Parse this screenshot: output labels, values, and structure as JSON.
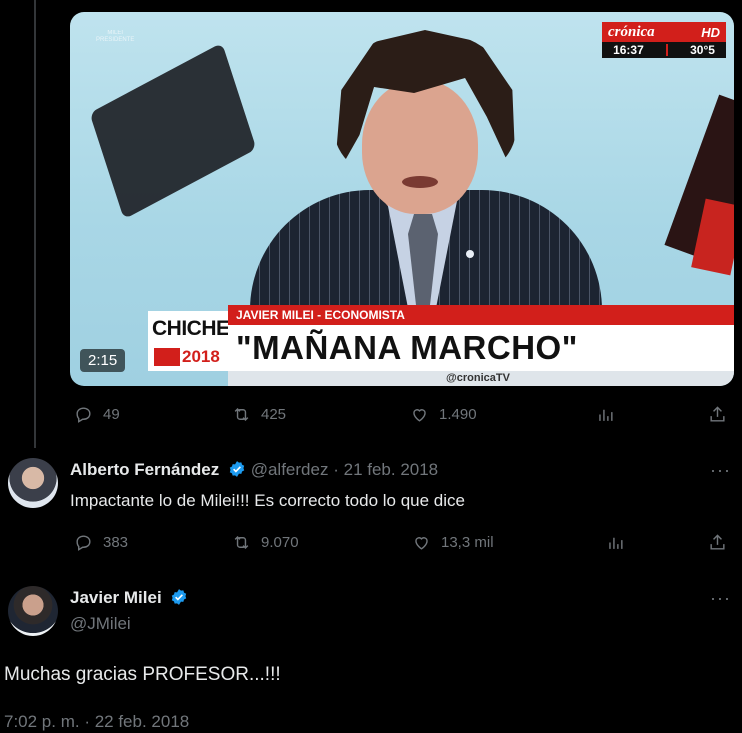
{
  "video": {
    "watermark_line1": "MILEI",
    "watermark_line2": "PRESIDENTE",
    "channel_brand": "crónica",
    "channel_hd": "HD",
    "clock": "16:37",
    "temperature": "30°5",
    "tag_line1": "CHICHE",
    "tag_year": "2018",
    "name_bar": "JAVIER MILEI - ECONOMISTA",
    "quote": "\"MAÑANA MARCHO\"",
    "handle": "@cronicaTV",
    "duration": "2:15"
  },
  "tweet1_actions": {
    "replies": "49",
    "retweets": "425",
    "likes": "1.490"
  },
  "tweet2": {
    "name": "Alberto Fernández",
    "handle": "@alferdez",
    "separator": "·",
    "date": "21 feb. 2018",
    "text": "Impactante lo de Milei!!! Es correcto todo lo que dice",
    "replies": "383",
    "retweets": "9.070",
    "likes": "13,3 mil",
    "more": "···"
  },
  "tweet3": {
    "name": "Javier Milei",
    "handle": "@JMilei",
    "text": "Muchas gracias PROFESOR...!!!",
    "timestamp": "7:02 p. m. · 22 feb. 2018",
    "more": "···"
  },
  "colors": {
    "background": "#000000",
    "text": "#e7e9ea",
    "muted": "#71767b",
    "verified": "#1d9bf0",
    "cronica_red": "#d21f1b"
  },
  "icons": [
    "reply-icon",
    "retweet-icon",
    "like-icon",
    "views-icon",
    "share-icon",
    "verified-badge-icon",
    "more-icon"
  ]
}
